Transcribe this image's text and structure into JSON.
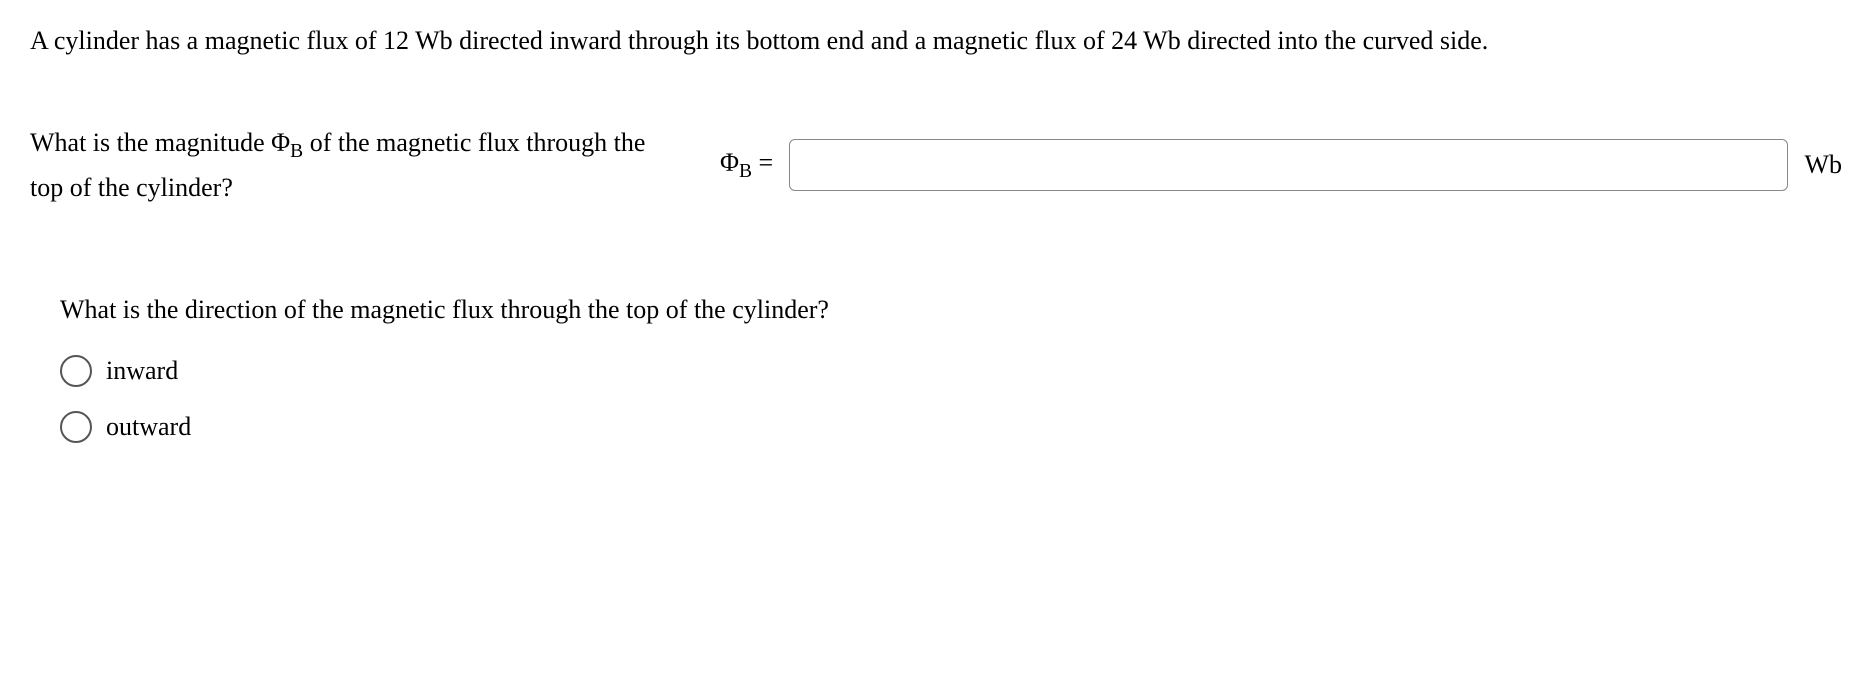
{
  "problem": {
    "statement": "A cylinder has a magnetic flux of 12 Wb directed inward through its bottom end and a magnetic flux of 24 Wb directed into the curved side."
  },
  "question1": {
    "text_line1": "What is the magnitude Φ",
    "text_sub": "B",
    "text_line1_cont": " of the magnetic flux through the",
    "text_line2": "top of the cylinder?",
    "answer_label_pre": "Φ",
    "answer_label_sub": "B",
    "answer_label_post": " =",
    "answer_value": "",
    "answer_unit": "Wb"
  },
  "question2": {
    "text": "What is the direction of the magnetic flux through the top of the cylinder?",
    "options": {
      "opt1": "inward",
      "opt2": "outward"
    }
  }
}
